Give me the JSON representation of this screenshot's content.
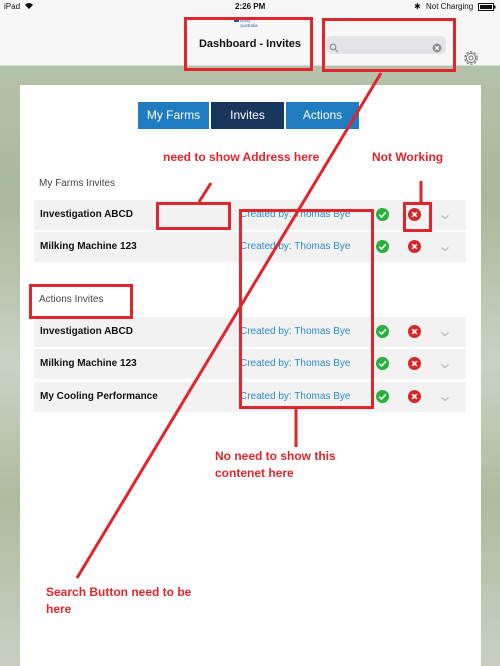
{
  "status_bar": {
    "device": "iPad",
    "time": "2:26 PM",
    "charging": "Not Charging"
  },
  "nav": {
    "logo_text": "Dairy Australia",
    "title": "Dashboard - Invites",
    "search_placeholder": "",
    "search_icon": "search-icon",
    "clear_icon": "close-circle-icon",
    "settings_icon": "gear-icon"
  },
  "tabs": [
    {
      "label": "My Farms",
      "active": false
    },
    {
      "label": "Invites",
      "active": true
    },
    {
      "label": "Actions",
      "active": false
    }
  ],
  "sections": {
    "my_farms": {
      "title": "My Farms Invites",
      "rows": [
        {
          "name": "Investigation ABCD",
          "created": ""
        },
        {
          "name": "Milking Machine 123",
          "created": "Created by: Thomas Bye"
        }
      ]
    },
    "actions": {
      "title": "Actions Invites",
      "rows": [
        {
          "name": "Investigation ABCD",
          "created": "Created by: Thomas Bye"
        },
        {
          "name": "Milking Machine 123",
          "created": "Created by: Thomas Bye"
        },
        {
          "name": "My Cooling Performance",
          "created": "Created by: Thomas Bye"
        }
      ]
    }
  },
  "annotations": {
    "address": "need to show Address here",
    "not_working": "Not Working",
    "no_need": "No need to show this contenet here",
    "search_button": "Search Button need to be here",
    "first_row_created": "Created by: Thomas Bye"
  },
  "colors": {
    "tab_blue": "#1f7cc1",
    "tab_active": "#16375b",
    "annotation_red": "#e0262b",
    "accept_green": "#27b13c",
    "reject_red": "#d9262b"
  }
}
